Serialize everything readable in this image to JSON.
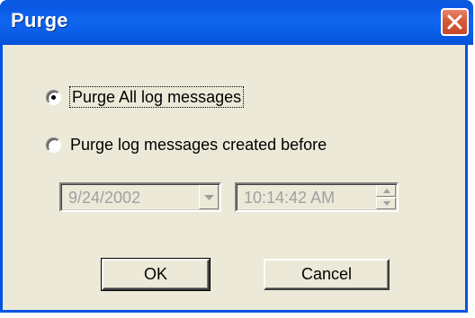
{
  "window": {
    "title": "Purge",
    "close_icon": "close-icon"
  },
  "options": {
    "purge_all": {
      "label": "Purge All log messages",
      "selected": true
    },
    "purge_before": {
      "label": "Purge log messages created before",
      "selected": false
    }
  },
  "date_picker": {
    "value": "9/24/2002",
    "enabled": false,
    "icon": "chevron-down-icon"
  },
  "time_picker": {
    "value": "10:14:42 AM",
    "enabled": false,
    "icons": [
      "spin-up-icon",
      "spin-down-icon"
    ]
  },
  "buttons": {
    "ok_label": "OK",
    "cancel_label": "Cancel"
  },
  "colors": {
    "titlebar": "#0a58e4",
    "dialog_bg": "#ece9d8",
    "close_button": "#d55a3a",
    "disabled_text": "#a0a0a0"
  }
}
